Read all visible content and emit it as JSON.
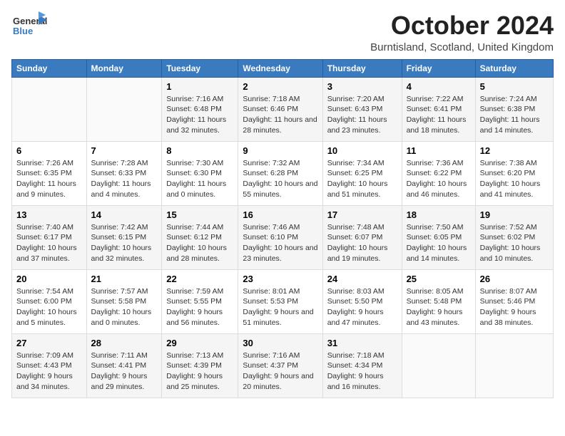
{
  "logo": {
    "line1": "General",
    "line2": "Blue"
  },
  "title": "October 2024",
  "location": "Burntisland, Scotland, United Kingdom",
  "headers": [
    "Sunday",
    "Monday",
    "Tuesday",
    "Wednesday",
    "Thursday",
    "Friday",
    "Saturday"
  ],
  "weeks": [
    [
      {
        "day": "",
        "sunrise": "",
        "sunset": "",
        "daylight": ""
      },
      {
        "day": "",
        "sunrise": "",
        "sunset": "",
        "daylight": ""
      },
      {
        "day": "1",
        "sunrise": "Sunrise: 7:16 AM",
        "sunset": "Sunset: 6:48 PM",
        "daylight": "Daylight: 11 hours and 32 minutes."
      },
      {
        "day": "2",
        "sunrise": "Sunrise: 7:18 AM",
        "sunset": "Sunset: 6:46 PM",
        "daylight": "Daylight: 11 hours and 28 minutes."
      },
      {
        "day": "3",
        "sunrise": "Sunrise: 7:20 AM",
        "sunset": "Sunset: 6:43 PM",
        "daylight": "Daylight: 11 hours and 23 minutes."
      },
      {
        "day": "4",
        "sunrise": "Sunrise: 7:22 AM",
        "sunset": "Sunset: 6:41 PM",
        "daylight": "Daylight: 11 hours and 18 minutes."
      },
      {
        "day": "5",
        "sunrise": "Sunrise: 7:24 AM",
        "sunset": "Sunset: 6:38 PM",
        "daylight": "Daylight: 11 hours and 14 minutes."
      }
    ],
    [
      {
        "day": "6",
        "sunrise": "Sunrise: 7:26 AM",
        "sunset": "Sunset: 6:35 PM",
        "daylight": "Daylight: 11 hours and 9 minutes."
      },
      {
        "day": "7",
        "sunrise": "Sunrise: 7:28 AM",
        "sunset": "Sunset: 6:33 PM",
        "daylight": "Daylight: 11 hours and 4 minutes."
      },
      {
        "day": "8",
        "sunrise": "Sunrise: 7:30 AM",
        "sunset": "Sunset: 6:30 PM",
        "daylight": "Daylight: 11 hours and 0 minutes."
      },
      {
        "day": "9",
        "sunrise": "Sunrise: 7:32 AM",
        "sunset": "Sunset: 6:28 PM",
        "daylight": "Daylight: 10 hours and 55 minutes."
      },
      {
        "day": "10",
        "sunrise": "Sunrise: 7:34 AM",
        "sunset": "Sunset: 6:25 PM",
        "daylight": "Daylight: 10 hours and 51 minutes."
      },
      {
        "day": "11",
        "sunrise": "Sunrise: 7:36 AM",
        "sunset": "Sunset: 6:22 PM",
        "daylight": "Daylight: 10 hours and 46 minutes."
      },
      {
        "day": "12",
        "sunrise": "Sunrise: 7:38 AM",
        "sunset": "Sunset: 6:20 PM",
        "daylight": "Daylight: 10 hours and 41 minutes."
      }
    ],
    [
      {
        "day": "13",
        "sunrise": "Sunrise: 7:40 AM",
        "sunset": "Sunset: 6:17 PM",
        "daylight": "Daylight: 10 hours and 37 minutes."
      },
      {
        "day": "14",
        "sunrise": "Sunrise: 7:42 AM",
        "sunset": "Sunset: 6:15 PM",
        "daylight": "Daylight: 10 hours and 32 minutes."
      },
      {
        "day": "15",
        "sunrise": "Sunrise: 7:44 AM",
        "sunset": "Sunset: 6:12 PM",
        "daylight": "Daylight: 10 hours and 28 minutes."
      },
      {
        "day": "16",
        "sunrise": "Sunrise: 7:46 AM",
        "sunset": "Sunset: 6:10 PM",
        "daylight": "Daylight: 10 hours and 23 minutes."
      },
      {
        "day": "17",
        "sunrise": "Sunrise: 7:48 AM",
        "sunset": "Sunset: 6:07 PM",
        "daylight": "Daylight: 10 hours and 19 minutes."
      },
      {
        "day": "18",
        "sunrise": "Sunrise: 7:50 AM",
        "sunset": "Sunset: 6:05 PM",
        "daylight": "Daylight: 10 hours and 14 minutes."
      },
      {
        "day": "19",
        "sunrise": "Sunrise: 7:52 AM",
        "sunset": "Sunset: 6:02 PM",
        "daylight": "Daylight: 10 hours and 10 minutes."
      }
    ],
    [
      {
        "day": "20",
        "sunrise": "Sunrise: 7:54 AM",
        "sunset": "Sunset: 6:00 PM",
        "daylight": "Daylight: 10 hours and 5 minutes."
      },
      {
        "day": "21",
        "sunrise": "Sunrise: 7:57 AM",
        "sunset": "Sunset: 5:58 PM",
        "daylight": "Daylight: 10 hours and 0 minutes."
      },
      {
        "day": "22",
        "sunrise": "Sunrise: 7:59 AM",
        "sunset": "Sunset: 5:55 PM",
        "daylight": "Daylight: 9 hours and 56 minutes."
      },
      {
        "day": "23",
        "sunrise": "Sunrise: 8:01 AM",
        "sunset": "Sunset: 5:53 PM",
        "daylight": "Daylight: 9 hours and 51 minutes."
      },
      {
        "day": "24",
        "sunrise": "Sunrise: 8:03 AM",
        "sunset": "Sunset: 5:50 PM",
        "daylight": "Daylight: 9 hours and 47 minutes."
      },
      {
        "day": "25",
        "sunrise": "Sunrise: 8:05 AM",
        "sunset": "Sunset: 5:48 PM",
        "daylight": "Daylight: 9 hours and 43 minutes."
      },
      {
        "day": "26",
        "sunrise": "Sunrise: 8:07 AM",
        "sunset": "Sunset: 5:46 PM",
        "daylight": "Daylight: 9 hours and 38 minutes."
      }
    ],
    [
      {
        "day": "27",
        "sunrise": "Sunrise: 7:09 AM",
        "sunset": "Sunset: 4:43 PM",
        "daylight": "Daylight: 9 hours and 34 minutes."
      },
      {
        "day": "28",
        "sunrise": "Sunrise: 7:11 AM",
        "sunset": "Sunset: 4:41 PM",
        "daylight": "Daylight: 9 hours and 29 minutes."
      },
      {
        "day": "29",
        "sunrise": "Sunrise: 7:13 AM",
        "sunset": "Sunset: 4:39 PM",
        "daylight": "Daylight: 9 hours and 25 minutes."
      },
      {
        "day": "30",
        "sunrise": "Sunrise: 7:16 AM",
        "sunset": "Sunset: 4:37 PM",
        "daylight": "Daylight: 9 hours and 20 minutes."
      },
      {
        "day": "31",
        "sunrise": "Sunrise: 7:18 AM",
        "sunset": "Sunset: 4:34 PM",
        "daylight": "Daylight: 9 hours and 16 minutes."
      },
      {
        "day": "",
        "sunrise": "",
        "sunset": "",
        "daylight": ""
      },
      {
        "day": "",
        "sunrise": "",
        "sunset": "",
        "daylight": ""
      }
    ]
  ]
}
